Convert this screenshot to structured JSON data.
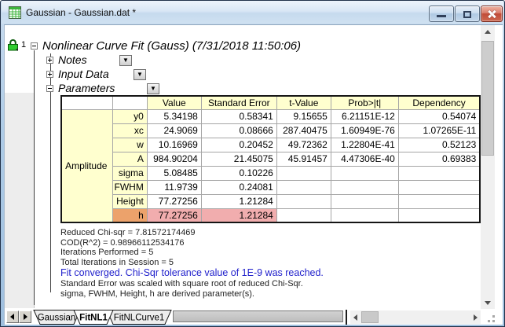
{
  "window": {
    "title": "Gaussian - Gaussian.dat *"
  },
  "report": {
    "lock_badge": "1",
    "root_label": "Nonlinear Curve Fit (Gauss) (7/31/2018 11:50:06)",
    "sections": [
      {
        "label": "Notes",
        "expanded": false
      },
      {
        "label": "Input Data",
        "expanded": false
      },
      {
        "label": "Parameters",
        "expanded": true
      }
    ]
  },
  "parameters_table": {
    "headers": {
      "value": "Value",
      "std_error": "Standard Error",
      "t_value": "t-Value",
      "prob": "Prob>|t|",
      "dependency": "Dependency"
    },
    "group_label": "Amplitude",
    "rows": [
      {
        "param": "y0",
        "value": "5.34198",
        "std_error": "0.58341",
        "t_value": "9.15655",
        "prob": "6.21151E-12",
        "dependency": "0.54074",
        "highlighted": false
      },
      {
        "param": "xc",
        "value": "24.9069",
        "std_error": "0.08666",
        "t_value": "287.40475",
        "prob": "1.60949E-76",
        "dependency": "1.07265E-11",
        "highlighted": false
      },
      {
        "param": "w",
        "value": "10.16969",
        "std_error": "0.20452",
        "t_value": "49.72362",
        "prob": "1.22804E-41",
        "dependency": "0.52123",
        "highlighted": false
      },
      {
        "param": "A",
        "value": "984.90204",
        "std_error": "21.45075",
        "t_value": "45.91457",
        "prob": "4.47306E-40",
        "dependency": "0.69383",
        "highlighted": false
      },
      {
        "param": "sigma",
        "value": "5.08485",
        "std_error": "0.10226",
        "t_value": "",
        "prob": "",
        "dependency": "",
        "highlighted": false
      },
      {
        "param": "FWHM",
        "value": "11.9739",
        "std_error": "0.24081",
        "t_value": "",
        "prob": "",
        "dependency": "",
        "highlighted": false
      },
      {
        "param": "Height",
        "value": "77.27256",
        "std_error": "1.21284",
        "t_value": "",
        "prob": "",
        "dependency": "",
        "highlighted": false
      },
      {
        "param": "h",
        "value": "77.27256",
        "std_error": "1.21284",
        "t_value": "",
        "prob": "",
        "dependency": "",
        "highlighted": true
      }
    ],
    "highlight_colors": {
      "param_cell": "#ECA26B",
      "value_cells": "#F1ADAE"
    },
    "header_fill": "#FFFFCF"
  },
  "fit_statistics": {
    "lines": [
      "Reduced Chi-sqr = 7.81572174469",
      "COD(R^2) = 0.98966112534176",
      "Iterations Performed = 5",
      "Total Iterations in Session = 5",
      "Fit converged. Chi-Sqr tolerance value of 1E-9 was reached.",
      "Standard Error was scaled with square root of reduced Chi-Sqr.",
      "sigma, FWHM, Height, h are derived parameter(s)."
    ],
    "converged_line_color": "#2222CC"
  },
  "sheet_tabs": [
    {
      "label": "Gaussian",
      "active": false
    },
    {
      "label": "FitNL1",
      "active": true
    },
    {
      "label": "FitNLCurve1",
      "active": false
    }
  ]
}
